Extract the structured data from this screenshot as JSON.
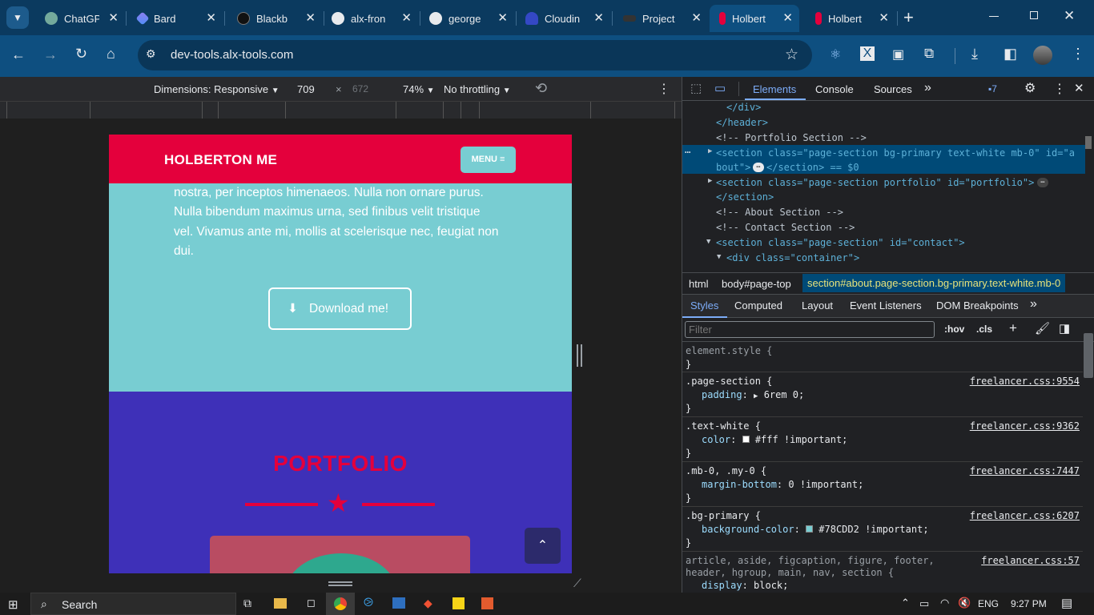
{
  "tabs": [
    {
      "title": "ChatGP",
      "color": "#74aa9c"
    },
    {
      "title": "Bard",
      "color": "#8e7cf0"
    },
    {
      "title": "Blackb",
      "color": "#2b2b2b"
    },
    {
      "title": "alx-fron",
      "color": "#e8eaed"
    },
    {
      "title": "george",
      "color": "#e8eaed"
    },
    {
      "title": "Cloudin",
      "color": "#3448c5"
    },
    {
      "title": "Project",
      "color": "#333333"
    },
    {
      "title": "Holbert",
      "color": "#e4003c"
    },
    {
      "title": "Holbert",
      "color": "#e4003c"
    }
  ],
  "address": {
    "url": "dev-tools.alx-tools.com"
  },
  "device_toolbar": {
    "dimensions": "Dimensions: Responsive",
    "width": "709",
    "times": "×",
    "height": "672",
    "zoom": "74%",
    "throttling": "No throttling"
  },
  "site": {
    "brand": "HOLBERTON ME",
    "menu": "MENU",
    "about_text_1": "nostra, per inceptos himenaeos. Nulla non ornare purus.",
    "about_text_2": "Nulla bibendum maximus urna, sed finibus velit tristique",
    "about_text_3": "vel. Vivamus ante mi, mollis at scelerisque nec, feugiat non",
    "about_text_4": "dui.",
    "download": "Download me!",
    "portfolio_heading": "PORTFOLIO",
    "colors": {
      "primary": "#78CDD2",
      "nav": "#e4003c",
      "portfolio_bg": "#3e30b8"
    }
  },
  "devtools": {
    "tabs": [
      "Elements",
      "Console",
      "Sources"
    ],
    "issues_count": "7",
    "dom": {
      "l1": "</div>",
      "l2": "</header>",
      "l3": "<!-- Portfolio Section -->",
      "l4a": "<section class=\"page-section bg-primary text-white mb-0\" id=\"a",
      "l4b": "bout\">",
      "l4c": "</section> == $0",
      "l5": "<section class=\"page-section portfolio\" id=\"portfolio\">",
      "l6": "</section>",
      "l7": "<!-- About Section -->",
      "l8": "<!-- Contact Section -->",
      "l9": "<section class=\"page-section\" id=\"contact\">",
      "l10": "<div class=\"container\">"
    },
    "breadcrumbs": [
      "html",
      "body#page-top",
      "section#about.page-section.bg-primary.text-white.mb-0"
    ],
    "style_tabs": [
      "Styles",
      "Computed",
      "Layout",
      "Event Listeners",
      "DOM Breakpoints"
    ],
    "filter_placeholder": "Filter",
    "hov": ":hov",
    "cls": ".cls",
    "rules": [
      {
        "selector": "element.style {",
        "props": [],
        "source": ""
      },
      {
        "selector": ".page-section {",
        "props": [
          {
            "name": "padding",
            "value": "6rem 0;"
          }
        ],
        "source": "freelancer.css:9554"
      },
      {
        "selector": ".text-white {",
        "props": [
          {
            "name": "color",
            "value": "#fff !important;"
          }
        ],
        "source": "freelancer.css:9362"
      },
      {
        "selector": ".mb-0, .my-0 {",
        "props": [
          {
            "name": "margin-bottom",
            "value": "0 !important;"
          }
        ],
        "source": "freelancer.css:7447"
      },
      {
        "selector": ".bg-primary {",
        "props": [
          {
            "name": "background-color",
            "value": "#78CDD2 !important;"
          }
        ],
        "source": "freelancer.css:6207"
      },
      {
        "selector": "article, aside, figcaption, figure, footer,",
        "props": [],
        "source": "freelancer.css:57"
      }
    ],
    "rule_last_line2": "header, hgroup, main, nav, section {",
    "rule_last_prop": {
      "name": "display",
      "value": "block;"
    }
  },
  "taskbar": {
    "search": "Search",
    "lang": "ENG",
    "time": "9:27 PM"
  }
}
